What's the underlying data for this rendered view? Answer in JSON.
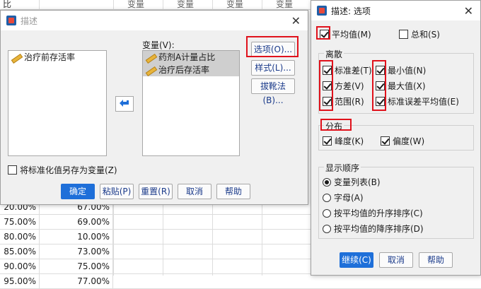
{
  "spreadsheet": {
    "header_text": "比",
    "col_header": "变量",
    "rows": [
      {
        "a": "20.00%",
        "b": "67.00%"
      },
      {
        "a": "75.00%",
        "b": "69.00%"
      },
      {
        "a": "80.00%",
        "b": "10.00%"
      },
      {
        "a": "85.00%",
        "b": "73.00%"
      },
      {
        "a": "90.00%",
        "b": "75.00%"
      },
      {
        "a": "95.00%",
        "b": "77.00%"
      }
    ]
  },
  "describe_dialog": {
    "title": "描述",
    "source_vars": [
      "治疗前存活率"
    ],
    "variables_label": "变量(V):",
    "target_vars": [
      "药剂A计量占比",
      "治疗后存活率"
    ],
    "buttons": {
      "options": "选项(O)...",
      "style": "样式(L)...",
      "bootstrap": "拔靴法(B)...",
      "ok": "确定",
      "paste": "粘贴(P)",
      "reset": "重置(R)",
      "cancel": "取消",
      "help": "帮助"
    },
    "save_standardized": "将标准化值另存为变量(Z)"
  },
  "options_dialog": {
    "title": "描述: 选项",
    "mean": "平均值(M)",
    "sum": "总和(S)",
    "dispersion_label": "离散",
    "std_dev": "标准差(T)",
    "variance": "方差(V)",
    "range": "范围(R)",
    "minimum": "最小值(N)",
    "maximum": "最大值(X)",
    "se_mean": "标准误差平均值(E)",
    "distribution_label": "分布",
    "kurtosis": "峰度(K)",
    "skewness": "偏度(W)",
    "display_order_label": "显示顺序",
    "order_options": [
      "变量列表(B)",
      "字母(A)",
      "按平均值的升序排序(C)",
      "按平均值的降序排序(D)"
    ],
    "buttons": {
      "continue": "继续(C)",
      "cancel": "取消",
      "help": "帮助"
    }
  },
  "colors": {
    "accent": "#1e6fd9",
    "highlight": "#e0121c"
  }
}
